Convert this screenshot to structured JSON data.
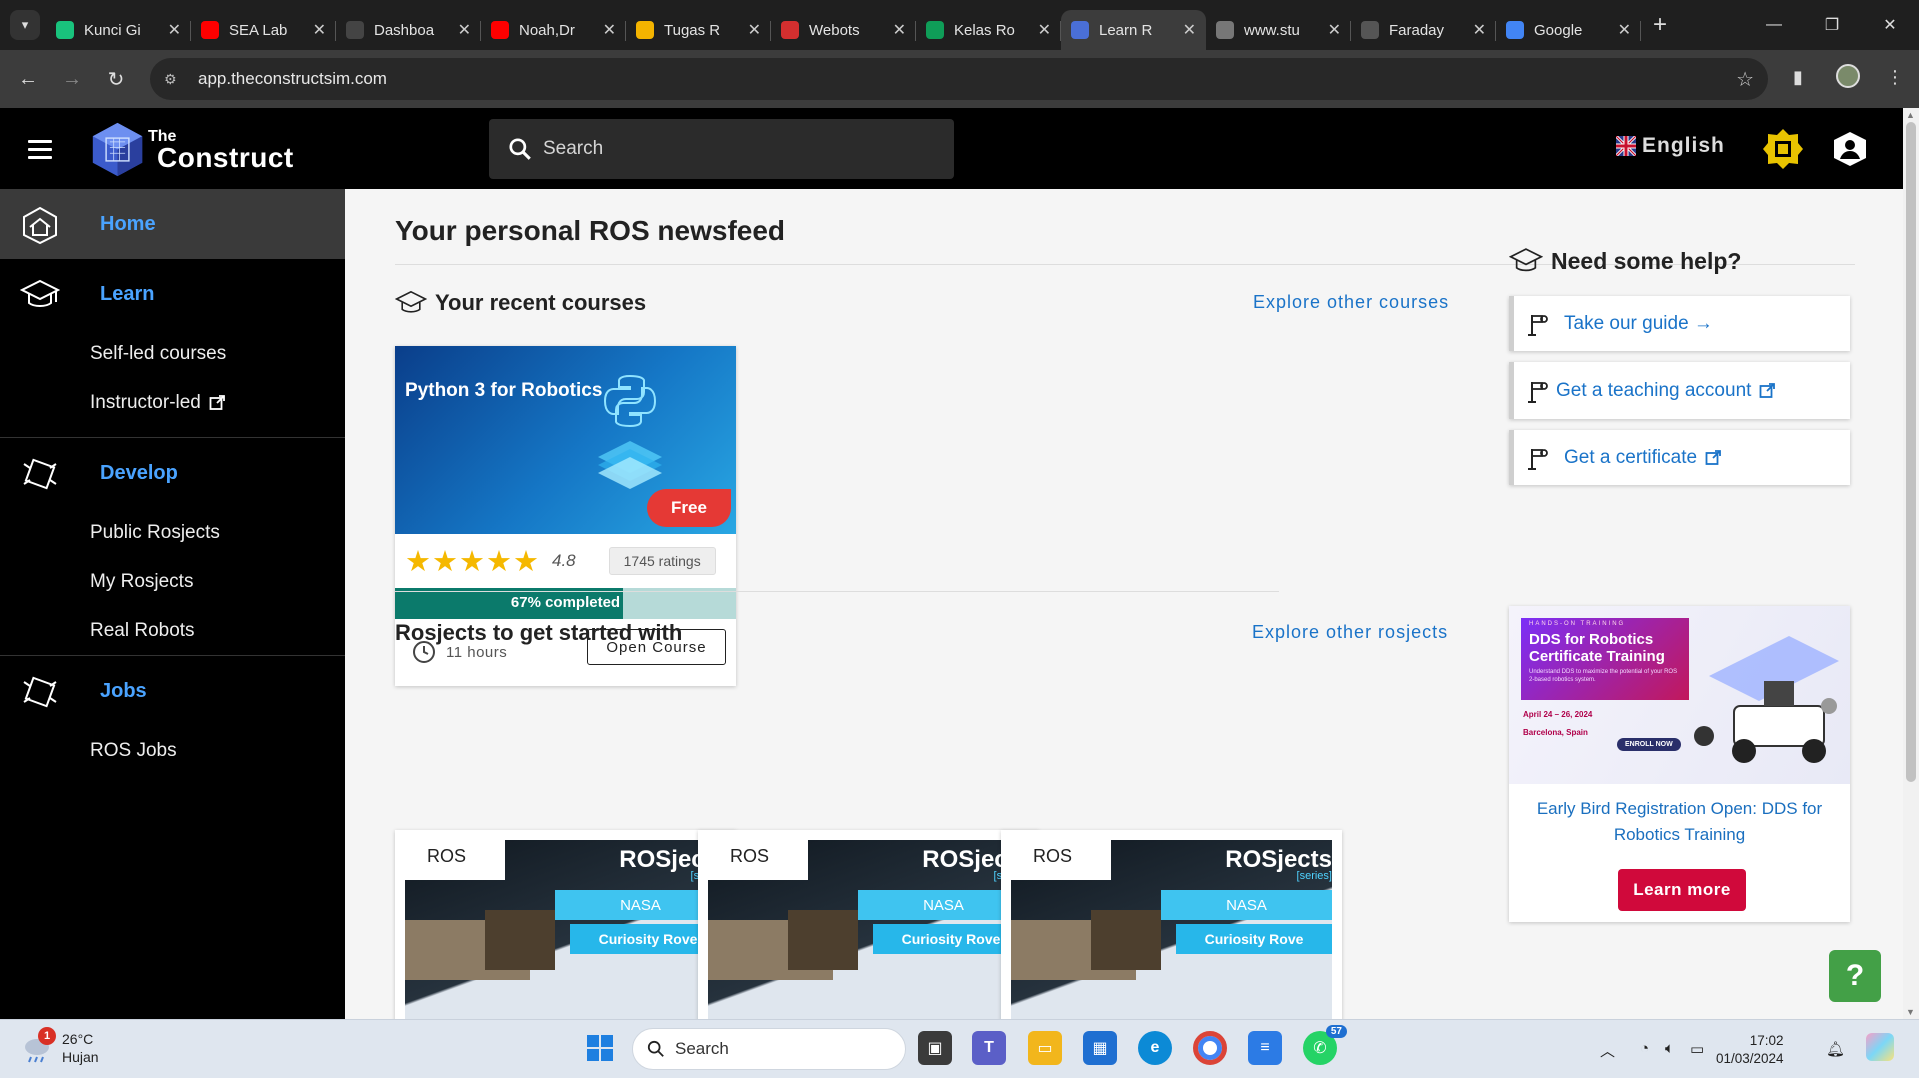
{
  "browser": {
    "tabs": [
      {
        "label": "Kunci Gi",
        "favicon_color": "#19c37d",
        "active": false
      },
      {
        "label": "SEA Lab",
        "favicon_color": "#ff0000",
        "active": false
      },
      {
        "label": "Dashboa",
        "favicon_color": "#444444",
        "active": false
      },
      {
        "label": "Noah,Dr",
        "favicon_color": "#ff0000",
        "active": false
      },
      {
        "label": "Tugas R",
        "favicon_color": "#f4b400",
        "active": false
      },
      {
        "label": "Webots",
        "favicon_color": "#d32f2f",
        "active": false
      },
      {
        "label": "Kelas Ro",
        "favicon_color": "#0f9d58",
        "active": false
      },
      {
        "label": "Learn R",
        "favicon_color": "#4a6fd6",
        "active": true
      },
      {
        "label": "www.stu",
        "favicon_color": "#777777",
        "active": false
      },
      {
        "label": "Faraday",
        "favicon_color": "#555555",
        "active": false
      },
      {
        "label": "Google",
        "favicon_color": "#4285f4",
        "active": false
      }
    ],
    "new_tab_symbol": "+",
    "url": "app.theconstructsim.com"
  },
  "header": {
    "logo_the": "The",
    "logo_construct": "Construct",
    "search_placeholder": "Search",
    "language": "English"
  },
  "sidebar": {
    "home": "Home",
    "learn": "Learn",
    "learn_items": [
      "Self-led courses",
      "Instructor-led"
    ],
    "develop": "Develop",
    "develop_items": [
      "Public Rosjects",
      "My Rosjects",
      "Real Robots"
    ],
    "jobs": "Jobs",
    "jobs_items": [
      "ROS Jobs"
    ]
  },
  "main": {
    "title": "Your personal ROS newsfeed",
    "recent_courses_title": "Your recent courses",
    "explore_courses": "Explore other courses",
    "course": {
      "title": "Python 3 for Robotics",
      "badge": "Free",
      "stars": "★★★★★",
      "rating": "4.8",
      "ratings_count": "1745 ratings",
      "progress_pct": 67,
      "progress_label": "67% completed",
      "duration": "11 hours",
      "open_button": "Open Course"
    },
    "rosjects_title": "Rosjects to get started with",
    "explore_rosjects": "Explore other rosjects",
    "rosjects": [
      {
        "brand": "ROS",
        "series_title": "ROSjects",
        "series_sub": "[series]",
        "tag1": "NASA",
        "tag2": "Curiosity Rove"
      },
      {
        "brand": "ROS",
        "series_title": "ROSjects",
        "series_sub": "[series]",
        "tag1": "NASA",
        "tag2": "Curiosity Rove"
      },
      {
        "brand": "ROS",
        "series_title": "ROSjects",
        "series_sub": "[series]",
        "tag1": "NASA",
        "tag2": "Curiosity Rove"
      }
    ]
  },
  "help": {
    "title": "Need some help?",
    "items": [
      "Take our guide →",
      "Get a teaching account",
      "Get a certificate"
    ],
    "promo": {
      "kicker": "HANDS-ON TRAINING",
      "image_title": "DDS for Robotics Certificate Training",
      "image_sub": "Understand DDS to maximize the potential of your ROS 2-based robotics system.",
      "date": "April 24 – 26, 2024",
      "place": "Barcelona, Spain",
      "enroll": "ENROLL NOW",
      "title": "Early Bird Registration Open: DDS for Robotics Training",
      "button": "Learn more"
    },
    "help_button": "?"
  },
  "taskbar": {
    "temperature": "26°C",
    "condition": "Hujan",
    "weather_badge": "1",
    "search": "Search",
    "whatsapp_badge": "57",
    "time": "17:02",
    "date": "01/03/2024"
  }
}
